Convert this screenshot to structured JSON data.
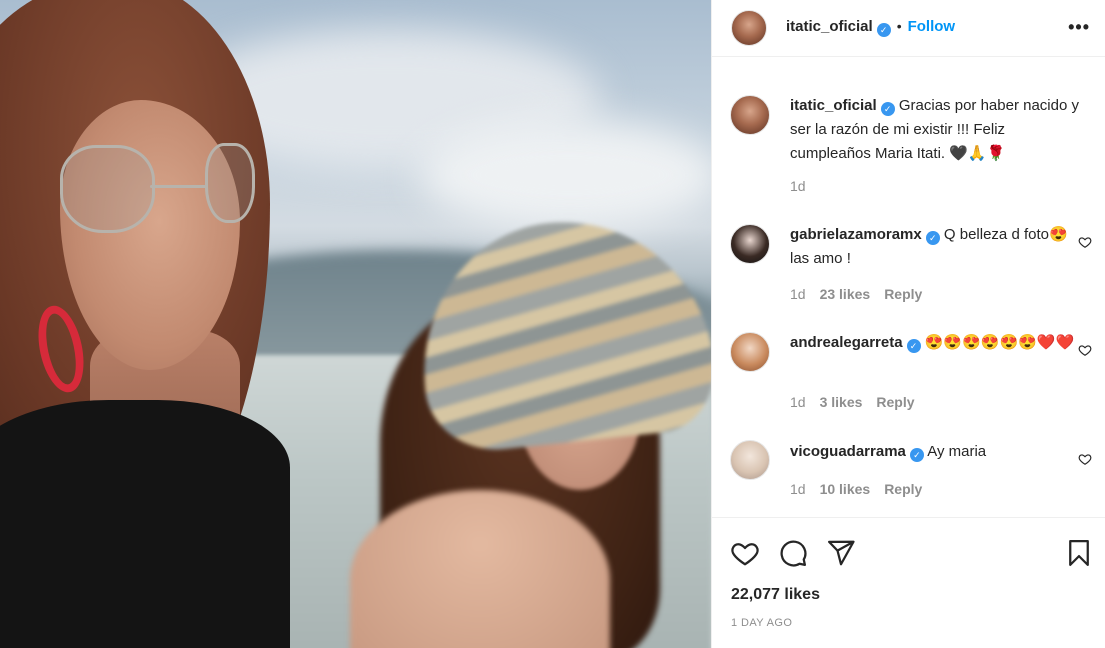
{
  "post": {
    "author": "itatic_oficial",
    "follow_label": "Follow",
    "separator": "•",
    "more_label": "•••",
    "verified_mark": "✓",
    "caption": {
      "username": "itatic_oficial",
      "text": "Gracias por haber nacido y ser la razón de mi existir !!! Feliz cumpleaños Maria Itati. 🖤🙏🌹",
      "time": "1d"
    },
    "comments": [
      {
        "username": "gabrielazamoramx",
        "text": "Q belleza d foto😍las amo !",
        "time": "1d",
        "likes": "23 likes",
        "reply": "Reply"
      },
      {
        "username": "andrealegarreta",
        "text": "😍😍😍😍😍😍❤️❤️",
        "time": "1d",
        "likes": "3 likes",
        "reply": "Reply"
      },
      {
        "username": "vicoguadarrama",
        "text": "Ay maria",
        "time": "1d",
        "likes": "10 likes",
        "reply": "Reply"
      }
    ],
    "likes_count": "22,077 likes",
    "posted_ago": "1 DAY AGO"
  },
  "icons": {
    "like": "heart-icon",
    "comment": "comment-icon",
    "share": "share-icon",
    "save": "bookmark-icon",
    "comment_like": "heart-icon"
  },
  "colors": {
    "follow": "#0095f6",
    "verified": "#3897f0",
    "meta": "#8e8e8e",
    "earring": "#d62a3a"
  }
}
